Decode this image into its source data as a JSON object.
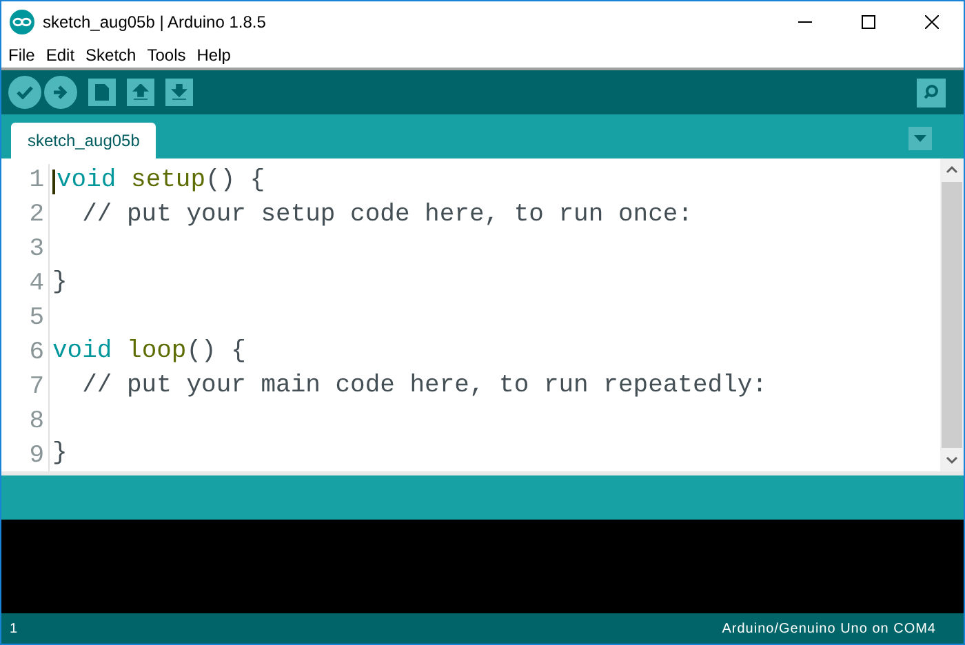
{
  "window": {
    "title": "sketch_aug05b | Arduino 1.8.5"
  },
  "menu": [
    "File",
    "Edit",
    "Sketch",
    "Tools",
    "Help"
  ],
  "tabs": [
    {
      "label": "sketch_aug05b",
      "selected": true
    }
  ],
  "editor": {
    "lines": [
      {
        "number": "1",
        "caret": true,
        "tokens": [
          {
            "kind": "keyword",
            "text": "void "
          },
          {
            "kind": "function",
            "text": "setup"
          },
          {
            "kind": "plain",
            "text": "() {"
          }
        ]
      },
      {
        "number": "2",
        "caret": false,
        "tokens": [
          {
            "kind": "comment",
            "text": "  // put your setup code here, to run once:"
          }
        ]
      },
      {
        "number": "3",
        "caret": false
      },
      {
        "number": "4",
        "caret": false,
        "tokens": [
          {
            "kind": "plain",
            "text": "}"
          }
        ]
      },
      {
        "number": "5",
        "caret": false
      },
      {
        "number": "6",
        "caret": false,
        "tokens": [
          {
            "kind": "keyword",
            "text": "void "
          },
          {
            "kind": "function",
            "text": "loop"
          },
          {
            "kind": "plain",
            "text": "() {"
          }
        ]
      },
      {
        "number": "7",
        "caret": false,
        "tokens": [
          {
            "kind": "comment",
            "text": "  // put your main code here, to run repeatedly:"
          }
        ]
      },
      {
        "number": "8",
        "caret": false
      },
      {
        "number": "9",
        "caret": false,
        "tokens": [
          {
            "kind": "plain",
            "text": "}"
          }
        ]
      }
    ]
  },
  "status_bar": {
    "line": "1",
    "board": "Arduino/Genuino Uno on COM4"
  }
}
